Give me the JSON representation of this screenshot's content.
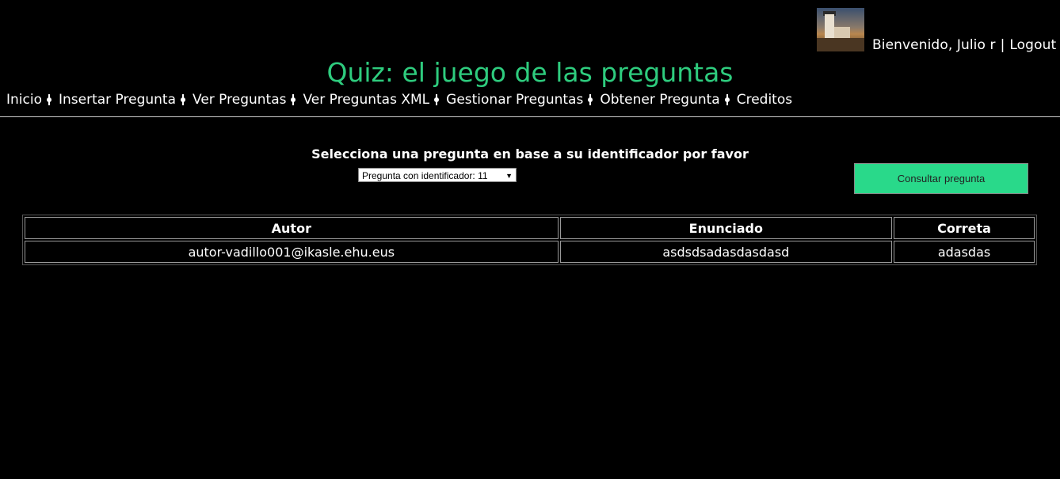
{
  "header": {
    "welcome_text": "Bienvenido, Julio r",
    "separator": "|",
    "logout_label": "Logout",
    "avatar_alt": "user avatar (lighthouse photo)"
  },
  "title": "Quiz: el juego de las preguntas",
  "nav": {
    "items": [
      "Inicio",
      "Insertar Pregunta",
      "Ver Preguntas",
      "Ver Preguntas XML",
      "Gestionar Preguntas",
      "Obtener Pregunta",
      "Creditos"
    ]
  },
  "form": {
    "prompt": "Selecciona una pregunta en base a su identificador por favor",
    "select_value": "Pregunta con identificador: 11",
    "button_label": "Consultar pregunta"
  },
  "table": {
    "headers": [
      "Autor",
      "Enunciado",
      "Correta"
    ],
    "rows": [
      [
        "autor-vadillo001@ikasle.ehu.eus",
        "asdsdsadasdasdasd",
        "adasdas"
      ]
    ]
  },
  "colors": {
    "background": "#000000",
    "title": "#2ecc7e",
    "button": "#29d98a"
  }
}
